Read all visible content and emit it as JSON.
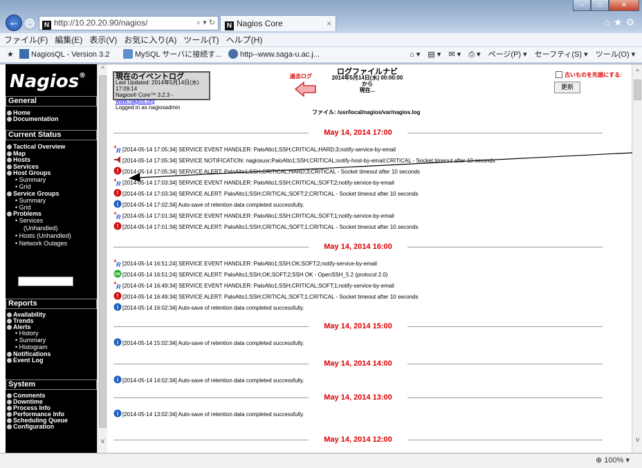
{
  "browser": {
    "url": "http://10.20.20.90/nagios/",
    "tab_title": "Nagios Core",
    "menu": [
      "ファイル(F)",
      "編集(E)",
      "表示(V)",
      "お気に入り(A)",
      "ツール(T)",
      "ヘルプ(H)"
    ],
    "favorites": [
      "NagiosQL - Version 3.2",
      "MySQL サーバに接続す...",
      "http--www.saga-u.ac.j..."
    ],
    "commands": [
      "ページ(P) ▾",
      "セーフティ(S) ▾",
      "ツール(O) ▾"
    ],
    "zoom": "100%"
  },
  "sidebar": {
    "logo": "Nagios",
    "logo_mark": "®",
    "general": {
      "header": "General",
      "items": [
        "Home",
        "Documentation"
      ]
    },
    "current_status": {
      "header": "Current Status",
      "items": [
        "Tactical Overview",
        "Map",
        "Hosts",
        "Services",
        "Host Groups"
      ],
      "host_groups_sub": [
        "Summary",
        "Grid"
      ],
      "service_groups": "Service Groups",
      "service_groups_sub": [
        "Summary",
        "Grid"
      ],
      "problems": "Problems",
      "problems_sub": [
        "Services",
        "(Unhandled)",
        "Hosts (Unhandled)",
        "Network Outages"
      ]
    },
    "reports": {
      "header": "Reports",
      "items": [
        "Availability",
        "Trends",
        "Alerts"
      ],
      "alerts_sub": [
        "History",
        "Summary",
        "Histogram"
      ],
      "more": [
        "Notifications",
        "Event Log"
      ]
    },
    "system": {
      "header": "System",
      "items": [
        "Comments",
        "Downtime",
        "Process Info",
        "Performance Info",
        "Scheduling Queue",
        "Configuration"
      ]
    }
  },
  "main": {
    "info": {
      "title": "現在のイベントログ",
      "updated": "Last Updated: 2014年5月14日(水) 17:09:14",
      "version": "Nagios® Core™ 3.2.3 - ",
      "version_link": "www.nagios.org",
      "logged": "Logged in as nagiosadmin"
    },
    "past_log": "過去ログ",
    "nav": {
      "title": "ログファイルナビ",
      "from": "2014年5月14日(水) 00:00:00",
      "kara": "から",
      "to": "現在..."
    },
    "file": "ファイル: /usr/local/nagios/var/nagios.log",
    "older_first": "古いものを先頭にする:",
    "update_button": "更新",
    "sections": [
      {
        "header": "May 14, 2014 17:00",
        "entries": [
          {
            "icon": "handler",
            "text": "[2014-05-14 17:05:34] SERVICE EVENT HANDLER: PaloAlto1;SSH;CRITICAL;HARD;3;notify-service-by-email"
          },
          {
            "icon": "notify",
            "text": "[2014-05-14 17:05:34] SERVICE NOTIFICATION: nagiosusr;PaloAlto1;SSH;CRITICAL;notify-host-by-email;CRITICAL - Socket timeout after 10 seconds"
          },
          {
            "icon": "critical",
            "text": "[2014-05-14 17:05:34] SERVICE ALERT: PaloAlto1;SSH;CRITICAL;HARD;3;CRITICAL - Socket timeout after 10 seconds"
          },
          {
            "icon": "handler",
            "text": "[2014-05-14 17:03:34] SERVICE EVENT HANDLER: PaloAlto1;SSH;CRITICAL;SOFT;2;notify-service-by-email"
          },
          {
            "icon": "critical",
            "text": "[2014-05-14 17:03:34] SERVICE ALERT: PaloAlto1;SSH;CRITICAL;SOFT;2;CRITICAL - Socket timeout after 10 seconds"
          },
          {
            "icon": "info",
            "text": "[2014-05-14 17:02:34] Auto-save of retention data completed successfully."
          },
          {
            "icon": "handler",
            "text": "[2014-05-14 17:01:34] SERVICE EVENT HANDLER: PaloAlto1;SSH;CRITICAL;SOFT;1;notify-service-by-email"
          },
          {
            "icon": "critical",
            "text": "[2014-05-14 17:01:34] SERVICE ALERT: PaloAlto1;SSH;CRITICAL;SOFT;1;CRITICAL - Socket timeout after 10 seconds"
          }
        ]
      },
      {
        "header": "May 14, 2014 16:00",
        "entries": [
          {
            "icon": "handler",
            "text": "[2014-05-14 16:51:24] SERVICE EVENT HANDLER: PaloAlto1;SSH;OK;SOFT;2;notify-service-by-email"
          },
          {
            "icon": "ok",
            "text": "[2014-05-14 16:51:24] SERVICE ALERT: PaloAlto1;SSH;OK;SOFT;2;SSH OK - OpenSSH_5.2 (protocol 2.0)"
          },
          {
            "icon": "handler",
            "text": "[2014-05-14 16:49:34] SERVICE EVENT HANDLER: PaloAlto1;SSH;CRITICAL;SOFT;1;notify-service-by-email"
          },
          {
            "icon": "critical",
            "text": "[2014-05-14 16:49:34] SERVICE ALERT: PaloAlto1;SSH;CRITICAL;SOFT;1;CRITICAL - Socket timeout after 10 seconds"
          },
          {
            "icon": "info",
            "text": "[2014-05-14 16:02:34] Auto-save of retention data completed successfully."
          }
        ]
      },
      {
        "header": "May 14, 2014 15:00",
        "entries": [
          {
            "icon": "info",
            "text": "[2014-05-14 15:02:34] Auto-save of retention data completed successfully."
          }
        ]
      },
      {
        "header": "May 14, 2014 14:00",
        "entries": [
          {
            "icon": "info",
            "text": "[2014-05-14 14:02:34] Auto-save of retention data completed successfully."
          }
        ]
      },
      {
        "header": "May 14, 2014 13:00",
        "entries": [
          {
            "icon": "info",
            "text": "[2014-05-14 13:02:34] Auto-save of retention data completed successfully."
          }
        ]
      },
      {
        "header": "May 14, 2014 12:00",
        "entries": []
      }
    ]
  },
  "colors": {
    "critical": "#cc1111",
    "info": "#1f5fbf",
    "ok": "#22aa22",
    "header_red": "#dd0000"
  }
}
